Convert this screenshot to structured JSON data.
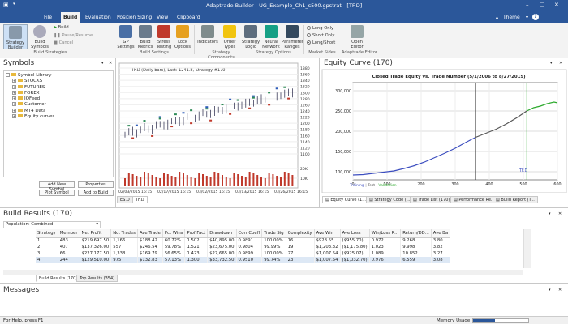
{
  "window": {
    "title": "Adaptrade Builder - UG_Example_Ch1_s500.gpstrat - [TF.D]"
  },
  "menu": {
    "items": [
      "File",
      "Build",
      "Evaluation",
      "Position Sizing",
      "View",
      "Clipboard"
    ],
    "active": "Build",
    "theme_label": "Theme"
  },
  "ribbon": {
    "strategy_builder": "Strategy Builder",
    "build_symbols": "Build Symbols",
    "build": "Build",
    "pause_resume": "Pause/Resume",
    "cancel": "Cancel",
    "gp_settings": "GP Settings",
    "build_metrics": "Build Metrics",
    "stress_testing": "Stress Testing",
    "lock_options": "Lock Options",
    "indicators": "Indicators",
    "order_types": "Order Types",
    "strategy_logic": "Strategy Logic",
    "neural_network": "Neural Network",
    "parameter_ranges": "Parameter Ranges",
    "long_only": "Long Only",
    "short_only": "Short Only",
    "long_short": "Long/Short",
    "open_editor": "Open Editor",
    "groups": {
      "build_strategies": "Build Strategies",
      "build_settings": "Build Settings",
      "strategy_components": "Strategy Components",
      "strategy_options": "Strategy Options",
      "market_sides": "Market Sides",
      "adaptrade_editor": "Adaptrade Editor"
    }
  },
  "symbols": {
    "title": "Symbols",
    "root": "Symbol Library",
    "items": [
      "STOCKS",
      "FUTURES",
      "FOREX",
      "IQFeed",
      "Customer",
      "MT4 Data",
      "Equity curves"
    ],
    "add_new_symbol": "Add New Symbol",
    "properties": "Properties",
    "plot_symbol": "Plot Symbol",
    "add_to_build": "Add to Build"
  },
  "price_chart": {
    "header": "TF.D (Daily bars), Last: 1241.8, Strategy #170",
    "y_ticks": [
      "1380",
      "1360",
      "1340",
      "1320",
      "1300",
      "1280",
      "1260",
      "1240",
      "1220",
      "1200",
      "1180",
      "1160",
      "1140",
      "1120",
      "1100",
      "20K",
      "10K"
    ],
    "x_ticks": [
      "02/03/2015 16:15",
      "02/17/2015 16:15",
      "03/02/2015 16:15",
      "03/13/2015 16:15",
      "03/26/2015 16:15"
    ],
    "tabs": [
      "ES.D",
      "TF.D"
    ]
  },
  "equity": {
    "title": "Equity Curve (170)",
    "plot_title": "Closed Trade Equity vs. Trade Number (5/1/2006 to 8/27/2015)",
    "y_ticks": [
      "300,000",
      "250,000",
      "200,000",
      "150,000",
      "100,000"
    ],
    "x_ticks": [
      "0",
      "100",
      "200",
      "300",
      "400",
      "500",
      "600"
    ],
    "symbol_label": "TF.D",
    "legend": [
      "Training",
      "Test",
      "Validation"
    ],
    "tabs": [
      "Equity Curve (1...",
      "Strategy Code (...",
      "Trade List (170)",
      "Performance Re...",
      "Build Report (T..."
    ]
  },
  "chart_data": {
    "type": "line",
    "title": "Closed Trade Equity vs. Trade Number (5/1/2006 to 8/27/2015)",
    "xlabel": "",
    "ylabel": "",
    "xlim": [
      0,
      600
    ],
    "ylim": [
      80000,
      320000
    ],
    "series": [
      {
        "name": "Training",
        "x": [
          0,
          30,
          60,
          90,
          120,
          150,
          180,
          210,
          240,
          270,
          300,
          330,
          360
        ],
        "y": [
          92000,
          93000,
          96000,
          99000,
          102000,
          108000,
          115000,
          124000,
          135000,
          146000,
          158000,
          172000,
          185000
        ]
      },
      {
        "name": "Test",
        "x": [
          360,
          390,
          420,
          450,
          480,
          510
        ],
        "y": [
          185000,
          195000,
          205000,
          218000,
          233000,
          250000
        ]
      },
      {
        "name": "Validation",
        "x": [
          510,
          530,
          550,
          570,
          590,
          600
        ],
        "y": [
          250000,
          258000,
          262000,
          268000,
          272000,
          270000
        ]
      }
    ],
    "vlines": [
      360,
      510
    ],
    "grid": true
  },
  "results": {
    "title": "Build Results (170)",
    "population": "Population: Combined",
    "columns": [
      "Strategy",
      "Member",
      "Net Profit",
      "No. Trades",
      "Ave Trade",
      "Pct Wins",
      "Prof Fact",
      "Drawdown",
      "Corr Coeff",
      "Trade Sig",
      "Complexity",
      "Ave Win",
      "Ave Loss",
      "Win/Loss R...",
      "Return/DD...",
      "Ave Ba"
    ],
    "rows": [
      [
        "1",
        "483",
        "$219,697.50",
        "1,166",
        "$188.42",
        "60.72%",
        "1.502",
        "$40,895.00",
        "0.9891",
        "100.00%",
        "16",
        "$928.55",
        "($955.70)",
        "0.972",
        "9.268",
        "3.80"
      ],
      [
        "2",
        "407",
        "$137,326.00",
        "557",
        "$246.54",
        "59.78%",
        "1.521",
        "$23,675.00",
        "0.9804",
        "99.99%",
        "19",
        "$1,203.32",
        "($1,175.80)",
        "1.023",
        "9.998",
        "3.82"
      ],
      [
        "3",
        "66",
        "$227,177.50",
        "1,338",
        "$169.79",
        "56.65%",
        "1.423",
        "$27,665.00",
        "0.9899",
        "100.00%",
        "27",
        "$1,007.54",
        "($925.07)",
        "1.089",
        "10.852",
        "3.27"
      ],
      [
        "4",
        "244",
        "$129,510.00",
        "975",
        "$132.83",
        "57.13%",
        "1.300",
        "$33,732.50",
        "0.9510",
        "99.74%",
        "23",
        "$1,007.54",
        "($1,032.70)",
        "0.976",
        "6.559",
        "3.08"
      ]
    ],
    "tabs": [
      "Build Results (170)",
      "Top Results (354)"
    ]
  },
  "messages": {
    "title": "Messages"
  },
  "status": {
    "help": "For Help, press F1",
    "memory": "Memory Usage"
  },
  "colors": {
    "titlebar": "#2b579a",
    "training": "#3b4dbf",
    "test": "#555555",
    "validation": "#2eaa2e",
    "selection": "#dde8f5"
  }
}
